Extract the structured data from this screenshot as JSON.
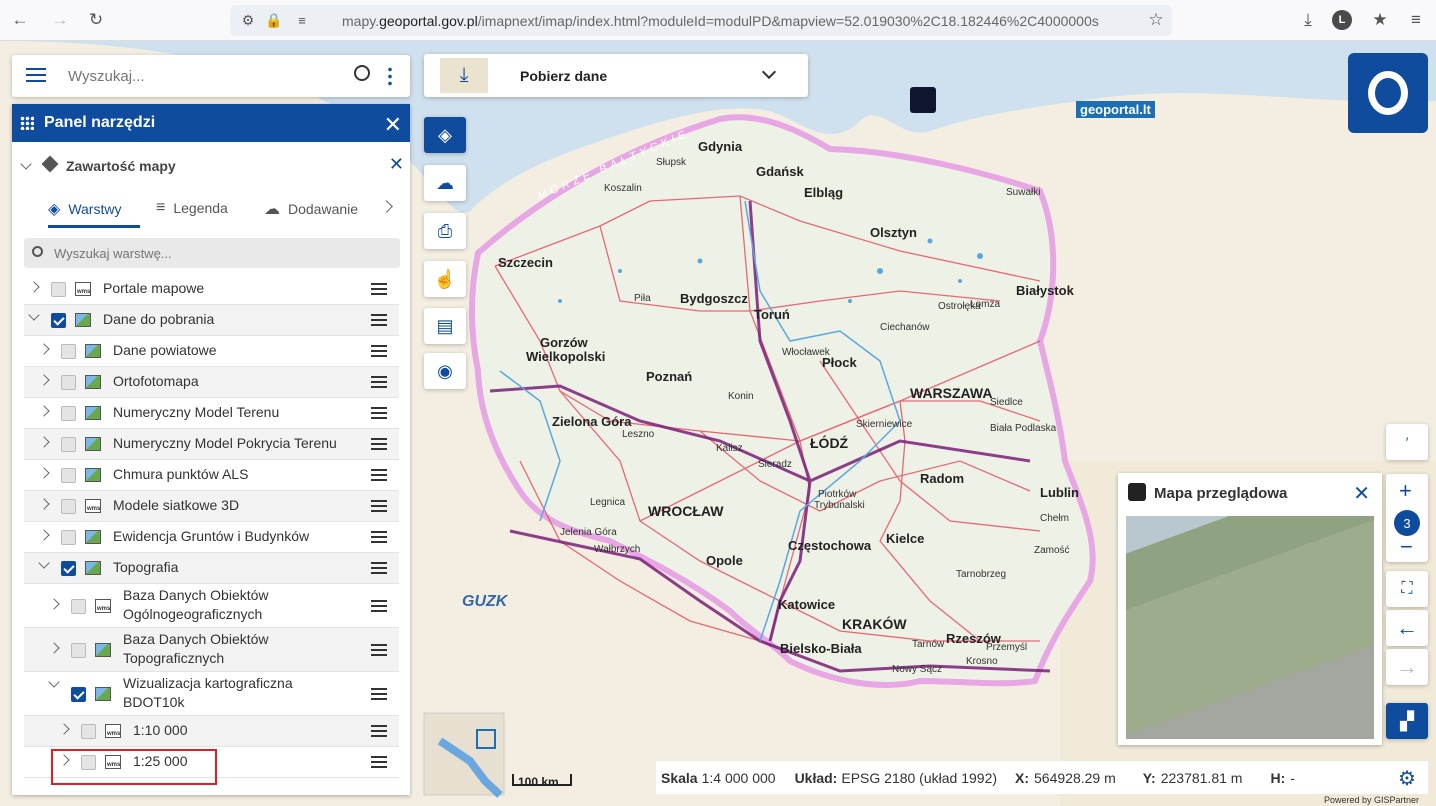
{
  "browser": {
    "url_prefix": "mapy.",
    "url_domain": "geoportal.gov.pl",
    "url_rest": "/imapnext/imap/index.html?moduleId=modulPD&mapview=52.019030%2C18.182446%2C4000000s",
    "profile_initial": "L"
  },
  "search": {
    "placeholder": "Wyszukaj..."
  },
  "download": {
    "label": "Pobierz dane"
  },
  "panel": {
    "title": "Panel narzędzi",
    "section_title": "Zawartość mapy",
    "tabs": [
      "Warstwy",
      "Legenda",
      "Dodawanie"
    ],
    "layer_search_placeholder": "Wyszukaj warstwę...",
    "layers": [
      {
        "label": "Portale mapowe",
        "checked": false,
        "expanded": false,
        "icon": "wms-layer-icon"
      },
      {
        "label": "Dane do pobrania",
        "checked": true,
        "expanded": true,
        "icon": "image-layer-icon"
      },
      {
        "label": "Dane powiatowe",
        "checked": false,
        "expanded": false,
        "icon": "image-layer-icon"
      },
      {
        "label": "Ortofotomapa",
        "checked": false,
        "expanded": false,
        "icon": "image-layer-icon"
      },
      {
        "label": "Numeryczny Model Terenu",
        "checked": false,
        "expanded": false,
        "icon": "image-layer-icon"
      },
      {
        "label": "Numeryczny Model Pokrycia Terenu",
        "checked": false,
        "expanded": false,
        "icon": "image-layer-icon"
      },
      {
        "label": "Chmura punktów ALS",
        "checked": false,
        "expanded": false,
        "icon": "image-layer-icon"
      },
      {
        "label": "Modele siatkowe 3D",
        "checked": false,
        "expanded": false,
        "icon": "wms-layer-icon"
      },
      {
        "label": "Ewidencja Gruntów i Budynków",
        "checked": false,
        "expanded": false,
        "icon": "image-layer-icon"
      },
      {
        "label": "Topografia",
        "checked": true,
        "expanded": true,
        "icon": "image-layer-icon"
      },
      {
        "label_line1": "Baza Danych Obiektów",
        "label_line2": "Ogólnogeograficznych",
        "checked": false,
        "expanded": false,
        "icon": "wms-layer-icon"
      },
      {
        "label_line1": "Baza Danych Obiektów",
        "label_line2": "Topograficznych",
        "checked": false,
        "expanded": false,
        "icon": "image-layer-icon"
      },
      {
        "label_line1": "Wizualizacja kartograficzna",
        "label_line2": "BDOT10k",
        "checked": true,
        "expanded": true,
        "icon": "image-layer-icon"
      },
      {
        "label": "1:10 000",
        "checked": false,
        "expanded": false,
        "icon": "wms-layer-icon"
      },
      {
        "label": "1:25 000",
        "checked": false,
        "expanded": false,
        "icon": "wms-layer-icon"
      }
    ]
  },
  "map": {
    "sea_label": "MORZE BAŁTYCKIE",
    "watermark": "geoportal.lt",
    "guzk_logo": "GUZK",
    "scale_bar": "100 km",
    "cities": [
      {
        "name": "Gdynia",
        "cls": "big"
      },
      {
        "name": "Gdańsk",
        "cls": "big"
      },
      {
        "name": "Elbląg",
        "cls": "big"
      },
      {
        "name": "Słupsk",
        "cls": "sm"
      },
      {
        "name": "Koszalin",
        "cls": "sm"
      },
      {
        "name": "Suwałki",
        "cls": "sm"
      },
      {
        "name": "Olsztyn",
        "cls": "big"
      },
      {
        "name": "Szczecin",
        "cls": "big"
      },
      {
        "name": "Białystok",
        "cls": "big"
      },
      {
        "name": "Bydgoszcz",
        "cls": "big"
      },
      {
        "name": "Toruń",
        "cls": "big"
      },
      {
        "name": "Piła",
        "cls": "sm"
      },
      {
        "name": "Łomża",
        "cls": "sm"
      },
      {
        "name": "Ostrołęka",
        "cls": "sm"
      },
      {
        "name": "Ciechanów",
        "cls": "sm"
      },
      {
        "name": "Gorzów",
        "cls": "big"
      },
      {
        "name": "Wielkopolski",
        "cls": "big"
      },
      {
        "name": "Włocławek",
        "cls": "sm"
      },
      {
        "name": "Płock",
        "cls": "big"
      },
      {
        "name": "Poznań",
        "cls": "big"
      },
      {
        "name": "WARSZAWA",
        "cls": "cap"
      },
      {
        "name": "Siedlce",
        "cls": "sm"
      },
      {
        "name": "Konin",
        "cls": "sm"
      },
      {
        "name": "Zielona Góra",
        "cls": "big"
      },
      {
        "name": "Leszno",
        "cls": "sm"
      },
      {
        "name": "Skierniewice",
        "cls": "sm"
      },
      {
        "name": "Biała Podlaska",
        "cls": "sm"
      },
      {
        "name": "ŁÓDŹ",
        "cls": "cap"
      },
      {
        "name": "Kalisz",
        "cls": "sm"
      },
      {
        "name": "Sieradz",
        "cls": "sm"
      },
      {
        "name": "Radom",
        "cls": "big"
      },
      {
        "name": "Lublin",
        "cls": "big"
      },
      {
        "name": "Piotrków",
        "cls": "sm"
      },
      {
        "name": "Trybunalski",
        "cls": "sm"
      },
      {
        "name": "Legnica",
        "cls": "sm"
      },
      {
        "name": "WROCŁAW",
        "cls": "cap"
      },
      {
        "name": "Chełm",
        "cls": "sm"
      },
      {
        "name": "Jelenia Góra",
        "cls": "sm"
      },
      {
        "name": "Wałbrzych",
        "cls": "sm"
      },
      {
        "name": "Kielce",
        "cls": "big"
      },
      {
        "name": "Zamość",
        "cls": "sm"
      },
      {
        "name": "Częstochowa",
        "cls": "big"
      },
      {
        "name": "Opole",
        "cls": "big"
      },
      {
        "name": "Tarnobrzeg",
        "cls": "sm"
      },
      {
        "name": "Katowice",
        "cls": "big"
      },
      {
        "name": "KRAKÓW",
        "cls": "cap"
      },
      {
        "name": "Rzeszów",
        "cls": "big"
      },
      {
        "name": "Tarnów",
        "cls": "sm"
      },
      {
        "name": "Przemyśl",
        "cls": "sm"
      },
      {
        "name": "Bielsko-Biała",
        "cls": "big"
      },
      {
        "name": "Krosno",
        "cls": "sm"
      },
      {
        "name": "Nowy Sącz",
        "cls": "sm"
      }
    ]
  },
  "overview": {
    "title": "Mapa przeglądowa"
  },
  "zoom": {
    "level": "3"
  },
  "status": {
    "scale_label": "Skala",
    "scale_value": "1:4 000 000",
    "crs_label": "Układ:",
    "crs_value": "EPSG 2180 (układ 1992)",
    "x_label": "X:",
    "x_value": "564928.29 m",
    "y_label": "Y:",
    "y_value": "223781.81 m",
    "h_label": "H:",
    "h_value": "-"
  },
  "powered_by": "Powered by GISPartner",
  "colors": {
    "primary": "#0f4c9e",
    "highlight": "#e02020"
  }
}
